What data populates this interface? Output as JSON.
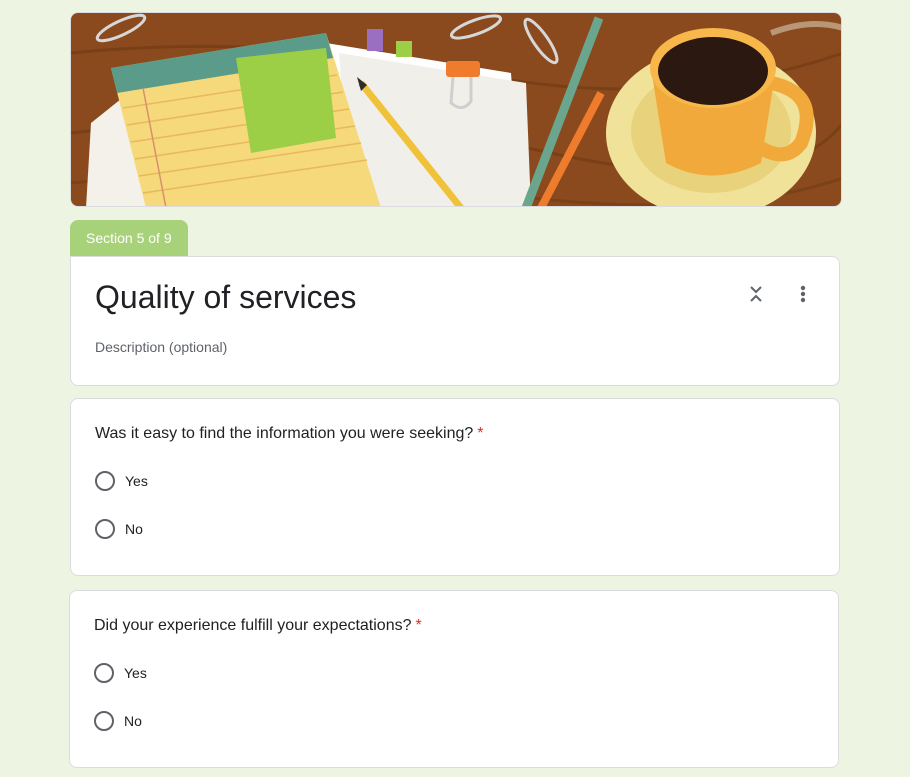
{
  "header": {
    "banner_icon": "desk-illustration-banner"
  },
  "section": {
    "tab_label": "Section 5 of 9",
    "title": "Quality of services",
    "description_placeholder": "Description (optional)",
    "colors": {
      "accent": "#a8d27a",
      "background": "#edf5e2"
    }
  },
  "questions": [
    {
      "text": "Was it easy to find the information you were seeking?",
      "required_mark": "*",
      "options": [
        "Yes",
        "No"
      ]
    },
    {
      "text": "Did your experience fulfill your expectations?",
      "required_mark": "*",
      "options": [
        "Yes",
        "No"
      ]
    }
  ],
  "icons": {
    "collapse": "collapse-icon",
    "more": "more-vert-icon"
  }
}
